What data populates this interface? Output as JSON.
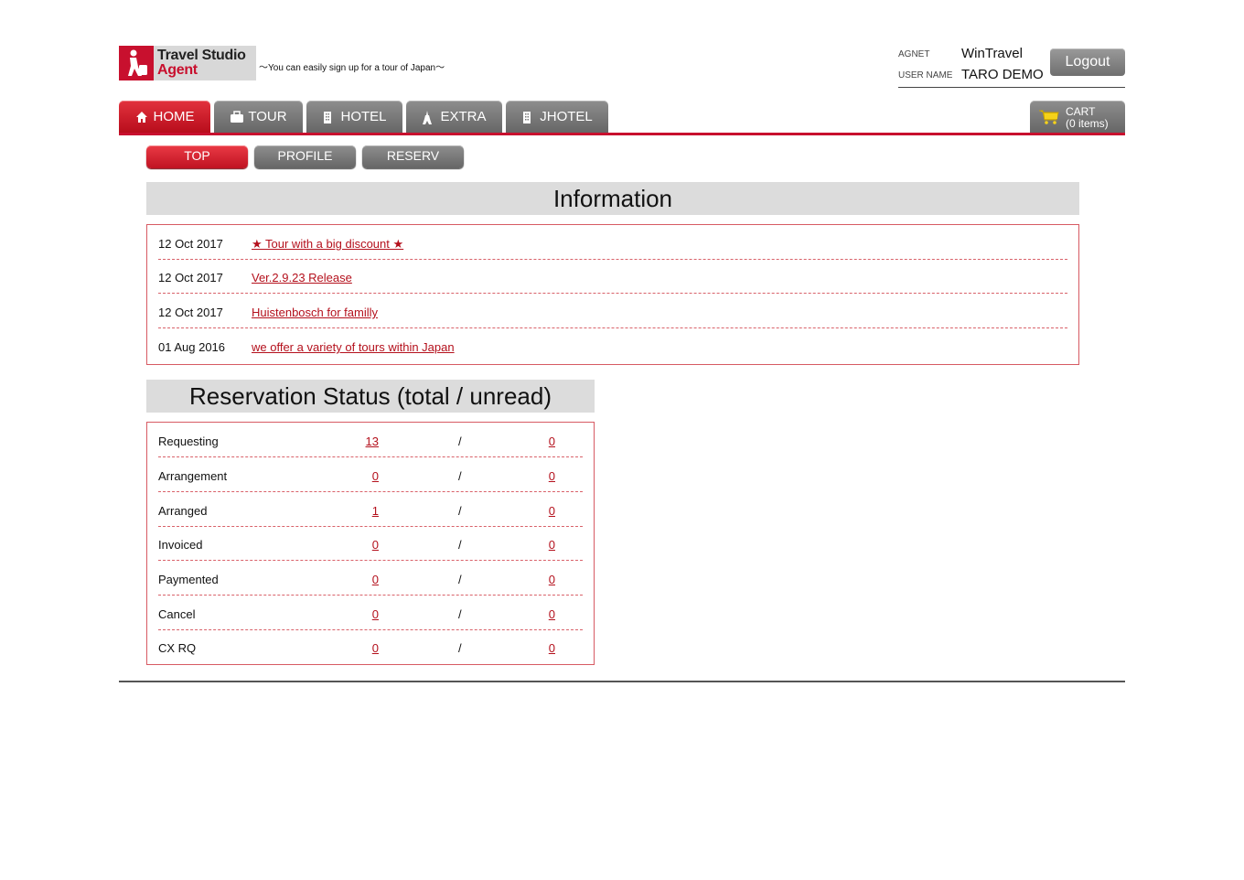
{
  "brand": {
    "logo_line1": "Travel Studio",
    "logo_line2": "Agent",
    "tagline": "〜You can easily sign up for a tour of Japan〜"
  },
  "user": {
    "agent_label": "AGNET",
    "agent_value": "WinTravel",
    "username_label": "USER NAME",
    "username_value": "TARO DEMO",
    "logout_label": "Logout"
  },
  "main_nav": [
    {
      "label": "HOME",
      "icon": "home-icon",
      "active": true
    },
    {
      "label": "TOUR",
      "icon": "suitcase-icon",
      "active": false
    },
    {
      "label": "HOTEL",
      "icon": "building-icon",
      "active": false
    },
    {
      "label": "EXTRA",
      "icon": "tower-icon",
      "active": false
    },
    {
      "label": "JHOTEL",
      "icon": "building-icon",
      "active": false
    }
  ],
  "cart": {
    "label": "CART",
    "count": "(0 items)",
    "icon": "cart-icon"
  },
  "sub_nav": [
    {
      "label": "TOP",
      "active": true
    },
    {
      "label": "PROFILE",
      "active": false
    },
    {
      "label": "RESERV",
      "active": false
    }
  ],
  "information": {
    "title": "Information",
    "items": [
      {
        "date": "12 Oct 2017",
        "text": "★ Tour with a big discount ★"
      },
      {
        "date": "12 Oct 2017",
        "text": "Ver.2.9.23 Release"
      },
      {
        "date": "12 Oct 2017",
        "text": "Huistenbosch for familly"
      },
      {
        "date": "01 Aug 2016",
        "text": "we offer a variety of tours within Japan"
      }
    ]
  },
  "reservation_status": {
    "title": "Reservation Status (total / unread)",
    "separator": "/",
    "rows": [
      {
        "label": "Requesting",
        "total": "13",
        "unread": "0"
      },
      {
        "label": "Arrangement",
        "total": "0",
        "unread": "0"
      },
      {
        "label": "Arranged",
        "total": "1",
        "unread": "0"
      },
      {
        "label": "Invoiced",
        "total": "0",
        "unread": "0"
      },
      {
        "label": "Paymented",
        "total": "0",
        "unread": "0"
      },
      {
        "label": "Cancel",
        "total": "0",
        "unread": "0"
      },
      {
        "label": "CX RQ",
        "total": "0",
        "unread": "0"
      }
    ]
  },
  "colors": {
    "accent": "#c8102e",
    "tab_gray": "#7a7a7a",
    "link": "#b4101c"
  }
}
